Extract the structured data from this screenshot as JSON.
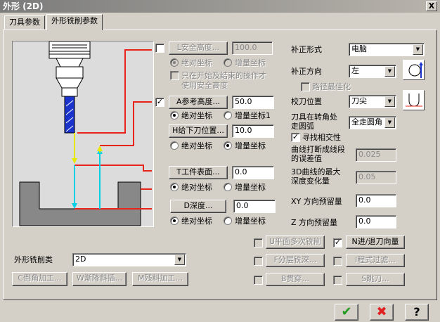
{
  "window": {
    "title": "外形 (2D)",
    "close_label": "X"
  },
  "tabs": [
    {
      "label": "刀具参数"
    },
    {
      "label": "外形铣削参数"
    }
  ],
  "params": {
    "safety": {
      "checked": false,
      "button": "L安全高度...",
      "value": "100.0",
      "abs": "绝对坐标",
      "inc": "增量坐标",
      "only_start_end": "只在开始及结束的操作才",
      "use_safety": "使用安全高度"
    },
    "retract": {
      "checked": true,
      "button": "A参考高度...",
      "value": "50.0",
      "abs": "绝对坐标",
      "inc": "增量坐标1"
    },
    "feed": {
      "button": "H给下刀位置...",
      "value": "10.0",
      "abs": "绝对坐标",
      "inc": "增量坐标"
    },
    "top": {
      "button": "T工件表面...",
      "value": "0.0",
      "abs": "绝对坐标",
      "inc": "增量坐标"
    },
    "depth": {
      "button": "D深度...",
      "value": "0.0",
      "abs": "绝对坐标",
      "inc": "增量坐标"
    }
  },
  "comp": {
    "type_label": "补正形式",
    "type_value": "电脑",
    "dir_label": "补正方向",
    "dir_value": "左",
    "optimize_label": "路径最佳化",
    "tip_label": "校刀位置",
    "tip_value": "刀尖",
    "corner_label_1": "刀具在转角处",
    "corner_label_2": "走圆弧",
    "corner_value": "全走圆角",
    "infinite_label": "寻找相交性",
    "tol_label_1": "曲线打断成线段",
    "tol_label_2": "的误差值",
    "tol_value": "0.025",
    "max_depth_label_1": "3D曲线的最大",
    "max_depth_label_2": "深度变化量",
    "max_depth_value": "0.05",
    "xy_stock_label": "XY 方向预留量",
    "xy_stock_value": "0.0",
    "z_stock_label": "Z 方向预留量",
    "z_stock_value": "0.0"
  },
  "contour": {
    "type_label": "外形铣削类",
    "type_value": "2D"
  },
  "bottom_buttons": {
    "chamfer": "C倒角加工...",
    "ramp": "W渐降斜插...",
    "remachine": "M残料加工...",
    "multi_pass": "U平面多次铣削",
    "lead": "N进/退刀向量",
    "depth_cuts": "F分层铣深...",
    "filter": "I程式过滤...",
    "break_through": "B贯穿...",
    "tabs": "S跳刀..."
  },
  "dialog_buttons": {
    "ok": "✔",
    "cancel": "✖",
    "help": "?"
  },
  "colors": {
    "red": "#e8231c",
    "blue": "#1a33cc",
    "yellow": "#e8e800",
    "cyan": "#00d0e8",
    "ok_green": "#1f9a1f",
    "cancel_red": "#e02020"
  }
}
